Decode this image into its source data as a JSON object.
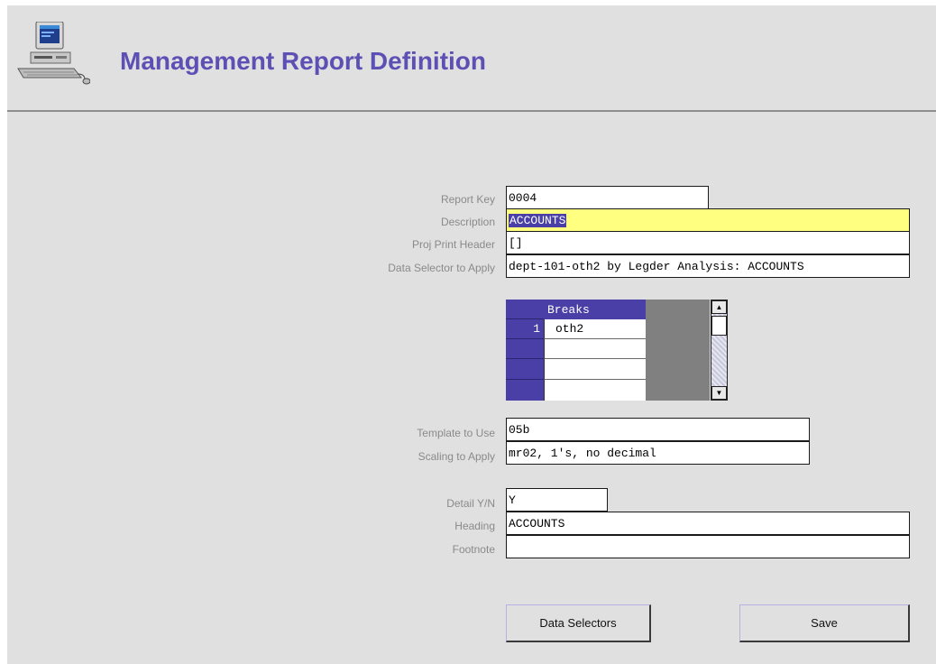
{
  "window": {
    "title": "Management Report Definition",
    "app_icon": "computer-icon"
  },
  "form": {
    "report_key": {
      "label": "Report Key",
      "value": "0004"
    },
    "description": {
      "label": "Description",
      "value": "ACCOUNTS"
    },
    "proj_print_header": {
      "label": "Proj Print Header",
      "value": "[]"
    },
    "data_selector": {
      "label": "Data Selector to Apply",
      "value": "dept-101-oth2 by Legder Analysis: ACCOUNTS"
    },
    "template": {
      "label": "Template to Use",
      "value": "05b"
    },
    "scaling": {
      "label": "Scaling to Apply",
      "value": "mr02, 1's, no decimal"
    },
    "detail": {
      "label": "Detail Y/N",
      "value": "Y"
    },
    "heading": {
      "label": "Heading",
      "value": "ACCOUNTS"
    },
    "footnote": {
      "label": "Footnote",
      "value": ""
    }
  },
  "breaks_grid": {
    "header": "Breaks",
    "rows": [
      {
        "num": "1",
        "value": "oth2"
      },
      {
        "num": "",
        "value": ""
      },
      {
        "num": "",
        "value": ""
      },
      {
        "num": "",
        "value": ""
      }
    ],
    "scroll_up": "▲",
    "scroll_down": "▼"
  },
  "buttons": {
    "data_selectors": "Data Selectors",
    "save": "Save"
  },
  "colors": {
    "title": "#5d50b4",
    "accent": "#4a3fa6",
    "highlight_field": "#ffff80",
    "background": "#e0e0e0"
  }
}
